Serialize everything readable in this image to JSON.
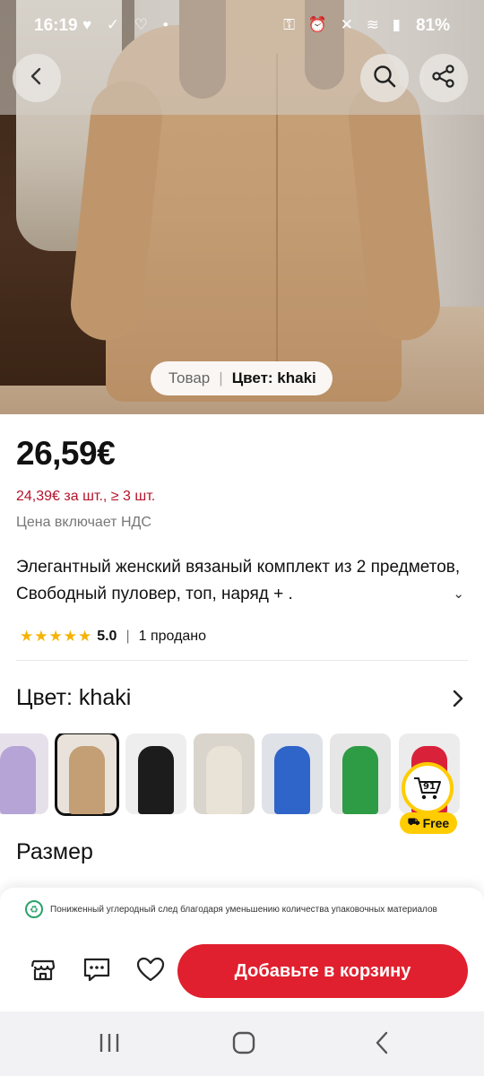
{
  "status_bar": {
    "time": "16:19",
    "battery": "81%",
    "left_icons": "♥ ✓ ♡ •",
    "right_icons": "⚿ ⏰ ✕ ≋ ▮"
  },
  "header": {
    "back_icon": "back-arrow-icon",
    "search_icon": "search-icon",
    "share_icon": "share-icon"
  },
  "image_overlay": {
    "left_label": "Товар",
    "separator": "|",
    "right_label": "Цвет: khaki"
  },
  "product": {
    "price": "26,59€",
    "bulk_price": "24,39€ за шт., ≥ 3 шт.",
    "vat_note": "Цена включает НДС",
    "title": "Элегантный женский вязаный комплект из 2 предметов, Свободный пуловер, топ, наряд + .",
    "rating_stars": "★★★★★",
    "rating_value": "5.0",
    "rating_separator": "|",
    "sold": "1 продано"
  },
  "color_section": {
    "label": "Цвет: khaki",
    "variants": [
      {
        "name": "lavender",
        "color": "#b6a4d6",
        "bg": "#e6e0ea"
      },
      {
        "name": "khaki",
        "color": "#c49e74",
        "bg": "#e8e2da",
        "selected": true
      },
      {
        "name": "black",
        "color": "#1c1c1c",
        "bg": "#eeeeee"
      },
      {
        "name": "cream",
        "color": "#e9e2d6",
        "bg": "#d9d4cc"
      },
      {
        "name": "blue",
        "color": "#2f64c8",
        "bg": "#dfe2e7"
      },
      {
        "name": "green",
        "color": "#2e9b45",
        "bg": "#e6e6e6"
      },
      {
        "name": "red",
        "color": "#d9223a",
        "bg": "#ececec"
      }
    ]
  },
  "free_shipping_badge": {
    "counter": "91",
    "label": "Free"
  },
  "size_section": {
    "label": "Размер"
  },
  "bottom_bar": {
    "eco_note": "Пониженный углеродный след благодаря уменьшению количества упаковочных материалов",
    "add_to_cart": "Добавьте в корзину"
  },
  "colors": {
    "accent_red": "#e0202e",
    "price_red": "#b3132a",
    "star_yellow": "#f5b400",
    "badge_yellow": "#ffcc00"
  }
}
